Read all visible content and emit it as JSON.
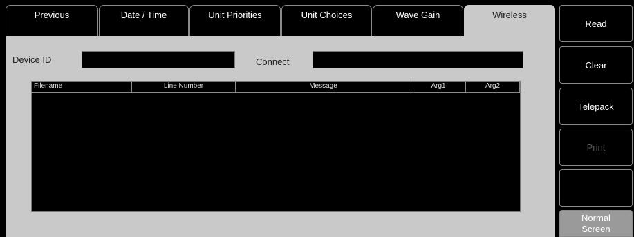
{
  "tabs": [
    {
      "label": "Previous"
    },
    {
      "label": "Date / Time"
    },
    {
      "label": "Unit Priorities"
    },
    {
      "label": "Unit Choices"
    },
    {
      "label": "Wave Gain"
    },
    {
      "label": "Wireless"
    }
  ],
  "active_tab": "Wireless",
  "form": {
    "device_id_label": "Device ID",
    "device_id_value": "",
    "connect_label": "Connect",
    "connect_value": ""
  },
  "log_table": {
    "columns": [
      "Filename",
      "Line Number",
      "Message",
      "Arg1",
      "Arg2"
    ],
    "rows": []
  },
  "side_buttons": [
    {
      "label": "Read",
      "enabled": true
    },
    {
      "label": "Clear",
      "enabled": true
    },
    {
      "label": "Telepack",
      "enabled": true
    },
    {
      "label": "Print",
      "enabled": false
    },
    {
      "label": "",
      "enabled": true
    },
    {
      "label": "Normal Screen",
      "enabled": true
    }
  ]
}
